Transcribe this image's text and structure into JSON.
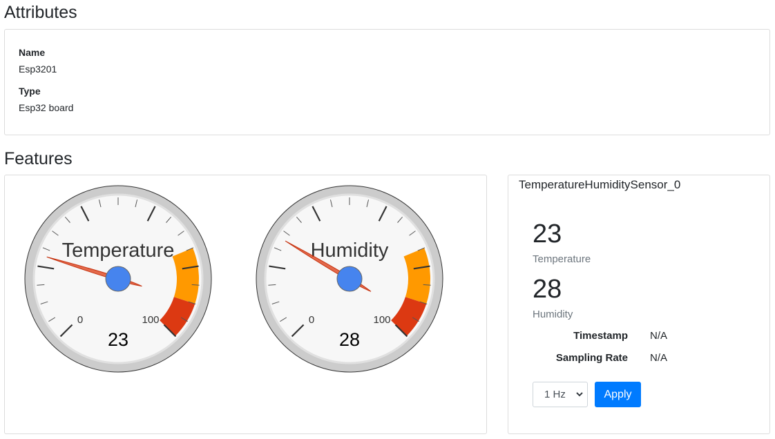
{
  "attributes": {
    "heading": "Attributes",
    "name_label": "Name",
    "name_value": "Esp3201",
    "type_label": "Type",
    "type_value": "Esp32 board"
  },
  "features": {
    "heading": "Features",
    "gauges": [
      {
        "title": "Temperature",
        "value": 23,
        "min_label": "0",
        "max_label": "100",
        "min": 0,
        "max": 100
      },
      {
        "title": "Humidity",
        "value": 28,
        "min_label": "0",
        "max_label": "100",
        "min": 0,
        "max": 100
      }
    ],
    "gauge_colors": {
      "needle": "#dc3912",
      "hub": "#4684ee",
      "yellow_band": "#ff9900",
      "red_band": "#dc3912"
    },
    "sensor": {
      "title": "TemperatureHumiditySensor_0",
      "readings": [
        {
          "value": "23",
          "label": "Temperature"
        },
        {
          "value": "28",
          "label": "Humidity"
        }
      ],
      "timestamp_label": "Timestamp",
      "timestamp_value": "N/A",
      "sampling_label": "Sampling Rate",
      "sampling_value": "N/A",
      "rate_select_value": "1 Hz",
      "apply_label": "Apply"
    }
  },
  "colors": {
    "primary": "#007bff",
    "muted": "#6c757d"
  }
}
